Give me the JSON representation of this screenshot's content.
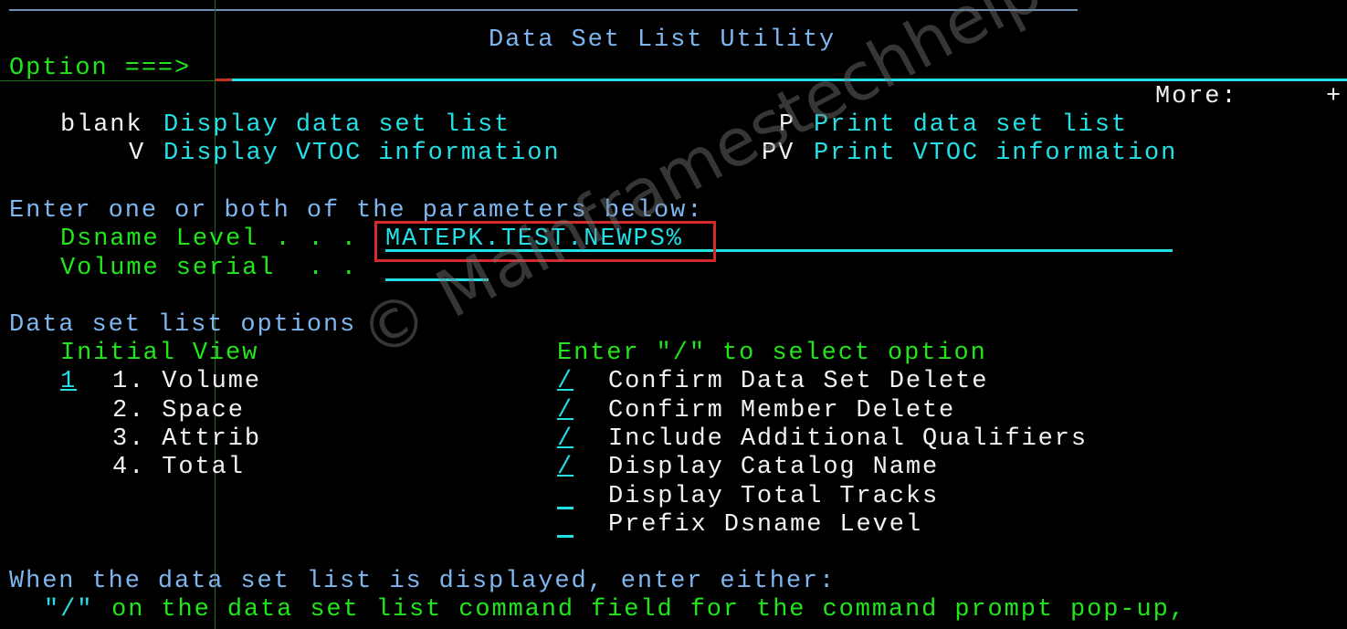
{
  "panel": {
    "title": "Data Set List Utility",
    "option_label": "Option ===>",
    "option_value": "",
    "more_label": "More:",
    "more_indicator": "+"
  },
  "commands": [
    {
      "key": "blank",
      "label": "Display data set list"
    },
    {
      "key": "V",
      "label": "Display VTOC information"
    },
    {
      "key": "P",
      "label": "Print data set list"
    },
    {
      "key": "PV",
      "label": "Print VTOC information"
    }
  ],
  "parameters": {
    "heading": "Enter one or both of the parameters below:",
    "dsname_label": "Dsname Level . . .",
    "dsname_value": "MATEPK.TEST.NEWPS%",
    "volume_label": "Volume serial  . .",
    "volume_value": ""
  },
  "list_options": {
    "heading": "Data set list options",
    "initial_view_heading": "Initial View",
    "initial_view_value": "1",
    "views": [
      "1. Volume",
      "2. Space",
      "3. Attrib",
      "4. Total"
    ],
    "select_heading": "Enter \"/\" to select option",
    "checks": [
      {
        "label": "Confirm Data Set Delete",
        "value": "/"
      },
      {
        "label": "Confirm Member Delete",
        "value": "/"
      },
      {
        "label": "Include Additional Qualifiers",
        "value": "/"
      },
      {
        "label": "Display Catalog Name",
        "value": "/"
      },
      {
        "label": "Display Total Tracks",
        "value": ""
      },
      {
        "label": "Prefix Dsname Level",
        "value": ""
      }
    ]
  },
  "footer": {
    "line1": "When the data set list is displayed, enter either:",
    "line2_prefix": "\"/\"",
    "line2_rest": " on the data set list command field for the command prompt pop-up,"
  },
  "watermark": "© Mainframestechhelp",
  "colors": {
    "blue": "#7eb6f0",
    "green": "#22e61c",
    "cyan": "#22e0e6",
    "white": "#f2f2f2",
    "highlight": "#d42a2a"
  }
}
